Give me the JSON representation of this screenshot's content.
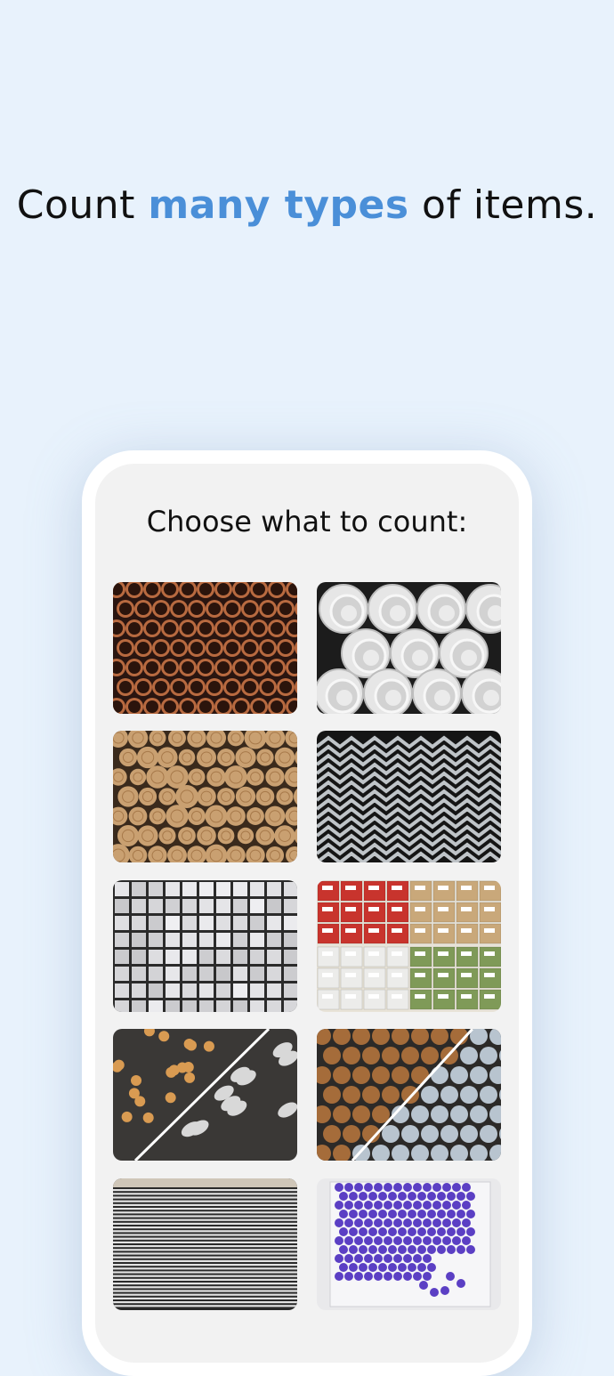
{
  "headline": {
    "prefix": "Count ",
    "accent": "many types",
    "suffix": " of items."
  },
  "screen": {
    "title": "Choose what to count:"
  },
  "colors": {
    "background": "#e8f2fc",
    "accent": "#4a8fd8"
  },
  "tiles": [
    {
      "name": "copper-pipes-image"
    },
    {
      "name": "pvc-pipes-image"
    },
    {
      "name": "timber-logs-image"
    },
    {
      "name": "steel-angles-image"
    },
    {
      "name": "metal-bars-image"
    },
    {
      "name": "boxes-image"
    },
    {
      "name": "pills-image"
    },
    {
      "name": "rebar-ends-image"
    },
    {
      "name": "sheet-stack-image"
    },
    {
      "name": "vials-image"
    }
  ]
}
